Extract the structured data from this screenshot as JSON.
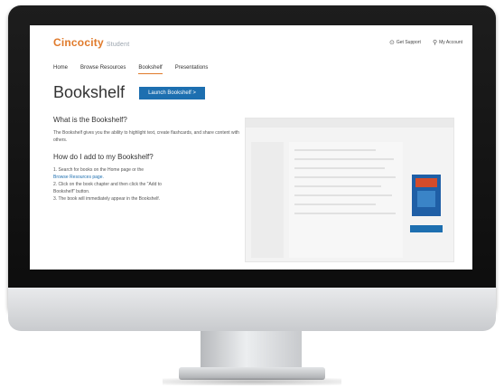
{
  "site": {
    "logo": "Cincocity",
    "logo_sub": "Student"
  },
  "header_links": [
    {
      "icon": "help-icon",
      "label": "Get Support"
    },
    {
      "icon": "account-icon",
      "label": "My Account"
    }
  ],
  "nav": {
    "items": [
      "Home",
      "Browse Resources",
      "Bookshelf",
      "Presentations"
    ],
    "active": "Bookshelf"
  },
  "page": {
    "title": "Bookshelf",
    "launch_button": "Launch Bookshelf >"
  },
  "content": {
    "what_title": "What is the Bookshelf?",
    "what_text": "The Bookshelf gives you the ability to highlight text, create flashcards, and share content with others.",
    "how_title": "How do I add to my Bookshelf?",
    "steps": [
      "1. Search for books on the Home page or the",
      "Browse Resources page.",
      "2. Click on the book chapter and then click the \"Add to",
      "Bookshelf\" button.",
      "3. The book will immediately appear in the Bookshelf."
    ]
  }
}
